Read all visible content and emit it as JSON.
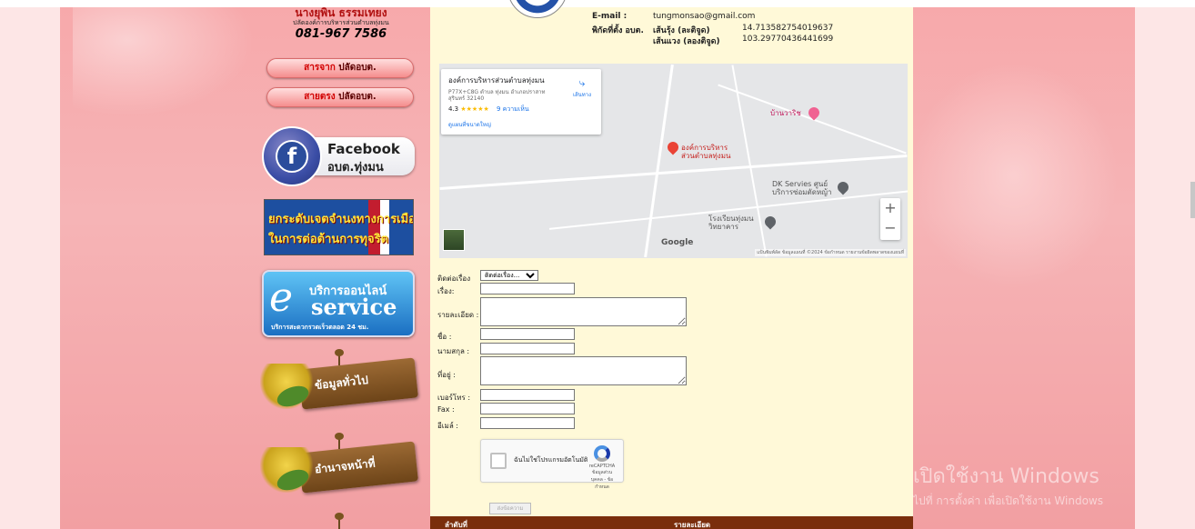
{
  "sidebar": {
    "contact": {
      "name": "นางยุพิน ธรรมเทยง",
      "position": "ปลัดองค์การบริหารส่วนตำบลทุ่งมน",
      "phone": "081-967 7586"
    },
    "pill_buttons": [
      {
        "prefix": "สารจาก",
        "text": "ปลัดอบต."
      },
      {
        "prefix": "สายตรง",
        "text": "ปลัดอบต."
      }
    ],
    "facebook": {
      "title": "Facebook",
      "subtitle": "อบต.ทุ่งมน",
      "icon_letter": "f"
    },
    "anti_corruption": {
      "line1": "ยกระดับเจตจำนงทางการเมือง",
      "line2": "ในการต่อต้านการทุจริต"
    },
    "eservice": {
      "top": "บริการออนไลน์",
      "letter": "e",
      "title": "service",
      "bottom": "บริการสะดวกรวดเร็วตลอด 24 ชม."
    },
    "menu": [
      {
        "label": "ข้อมูลทั่วไป"
      },
      {
        "label": "อำนาจหน้าที่"
      }
    ]
  },
  "info": {
    "email_label": "E-mail :",
    "email_value": "tungmonsao@gmail.com",
    "coord_label": "พิกัดที่ตั้ง อบต.",
    "lat_label": "เส้นรุ้ง (ละติจูด)",
    "lat_value": "14.713582754019637",
    "lng_label": "เส้นแวง (ลองติจูด)",
    "lng_value": "103.29770436441699"
  },
  "map": {
    "card": {
      "title": "องค์การบริหารส่วนตำบลทุ่งมน",
      "address": "P77X+C8G ตำบล ทุ่งมน อำเภอปราสาท สุรินทร์ 32140",
      "rating": "4.3",
      "stars": "★★★★★",
      "reviews": "9 ความเห็น",
      "larger_map": "ดูแผนที่ขนาดใหญ่",
      "directions": "เส้นทาง"
    },
    "main_pin_label": [
      "องค์การบริหาร",
      "ส่วนตำบลทุ่งมน"
    ],
    "places": [
      {
        "label": [
          "บ้านวาริช"
        ]
      },
      {
        "label": [
          "DK Servies ศูนย์",
          "บริการซ่อมตัดหญ้า"
        ]
      },
      {
        "label": [
          "โรงเรียนทุ่งมน",
          "วิทยาคาร"
        ]
      }
    ],
    "zoom_in": "+",
    "zoom_out": "−",
    "google": "Google",
    "footer": "แป้นพิมพ์ลัด   ข้อมูลแผนที่ ©2024   ข้อกำหนด   รายงานข้อผิดพลาดของแผนที่"
  },
  "form": {
    "topic_label": "ติดต่อเรื่อง",
    "topic_select": "ติดต่อเรื่อง...",
    "subject_label": "เรื่อง:",
    "detail_label": "รายละเอียด :",
    "name_label": "ชื่อ :",
    "lastname_label": "นามสกุล :",
    "address_label": "ที่อยู่ :",
    "phone_label": "เบอร์โทร :",
    "fax_label": "Fax :",
    "email_label": "อีเมล์ :",
    "captcha_text": "ฉันไม่ใช่โปรแกรมอัตโนมัติ",
    "captcha_brand": "reCAPTCHA",
    "captcha_links": "ข้อมูลส่วนบุคคล - ข้อกำหนด",
    "submit": "ส่งข้อความ"
  },
  "table": {
    "col1": "ลำดับที่",
    "col2": "รายละเอียด"
  },
  "watermark": {
    "line1": "เปิดใช้งาน Windows",
    "line2": "ไปที่ การตั้งค่า เพื่อเปิดใช้งาน Windows"
  }
}
